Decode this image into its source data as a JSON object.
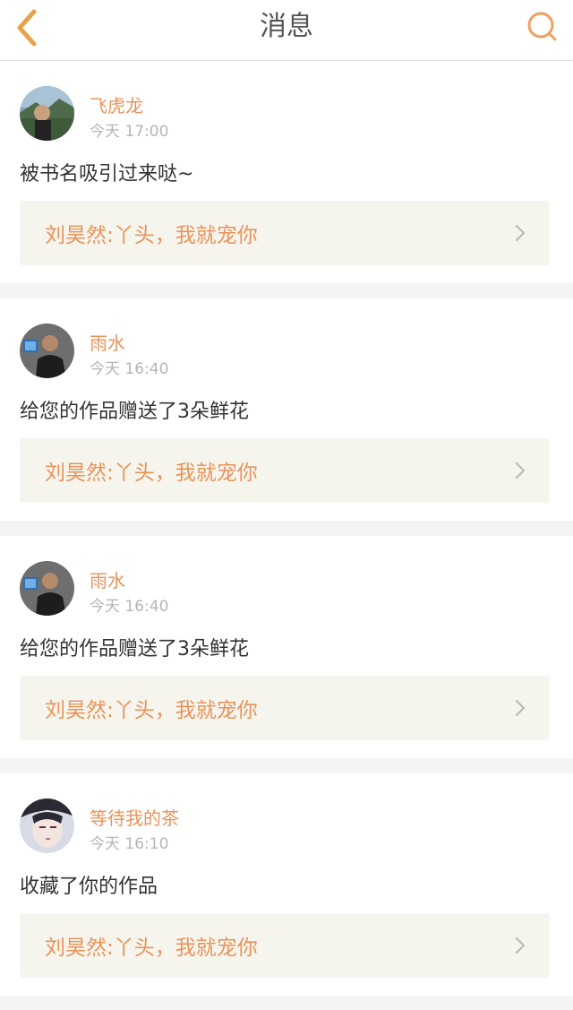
{
  "header": {
    "title": "消息",
    "back_icon": "chevron-left-icon",
    "search_icon": "search-icon",
    "accent": "#f0a060"
  },
  "messages": [
    {
      "name": "飞虎龙",
      "time": "今天 17:00",
      "content": "被书名吸引过来哒~",
      "ref": "刘昊然:丫头，我就宠你",
      "avatar": "avatar-landscape"
    },
    {
      "name": "雨水",
      "time": "今天 16:40",
      "content": "给您的作品赠送了3朵鲜花",
      "ref": "刘昊然:丫头，我就宠你",
      "avatar": "avatar-man-computer"
    },
    {
      "name": "雨水",
      "time": "今天 16:40",
      "content": "给您的作品赠送了3朵鲜花",
      "ref": "刘昊然:丫头，我就宠你",
      "avatar": "avatar-man-computer"
    },
    {
      "name": "等待我的茶",
      "time": "今天 16:10",
      "content": "收藏了你的作品",
      "ref": "刘昊然:丫头，我就宠你",
      "avatar": "avatar-anime-portrait"
    }
  ],
  "colors": {
    "name": "#e8935a",
    "time": "#b5b5b5",
    "ref_bg": "#f6f5ed",
    "page_bg": "#f4f4f4"
  }
}
